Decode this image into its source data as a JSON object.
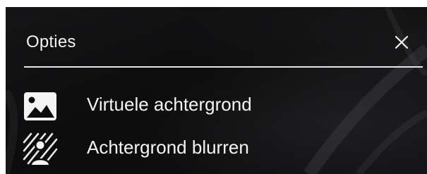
{
  "dialog": {
    "title": "Opties",
    "close_icon": "close-icon"
  },
  "options": [
    {
      "label": "Virtuele achtergrond",
      "icon": "image-icon"
    },
    {
      "label": "Achtergrond blurren",
      "icon": "blur-background-icon"
    }
  ],
  "colors": {
    "panel_background": "#0c0c0d",
    "text": "#f4f4f4",
    "divider": "#e6e6e6"
  }
}
